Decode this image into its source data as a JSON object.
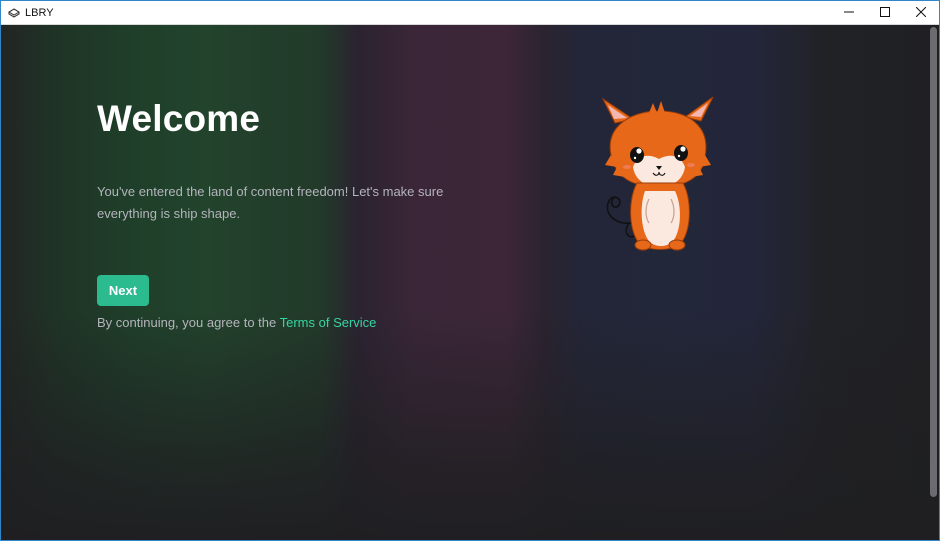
{
  "window": {
    "title": "LBRY",
    "controls": [
      "minimize-icon",
      "maximize-icon",
      "close-icon"
    ]
  },
  "welcome": {
    "title": "Welcome",
    "description": "You've entered the land of content freedom! Let's make sure everything is ship shape.",
    "next_label": "Next",
    "terms_prefix": "By continuing, you agree to the ",
    "terms_link": "Terms of Service"
  },
  "colors": {
    "accent": "#2bbb8f",
    "link": "#35d6a2",
    "text_muted": "#b4b4bc",
    "background": "#1f1f22",
    "mascot_orange": "#e8681a"
  },
  "images": {
    "mascot": "fox-mascot-illustration"
  }
}
